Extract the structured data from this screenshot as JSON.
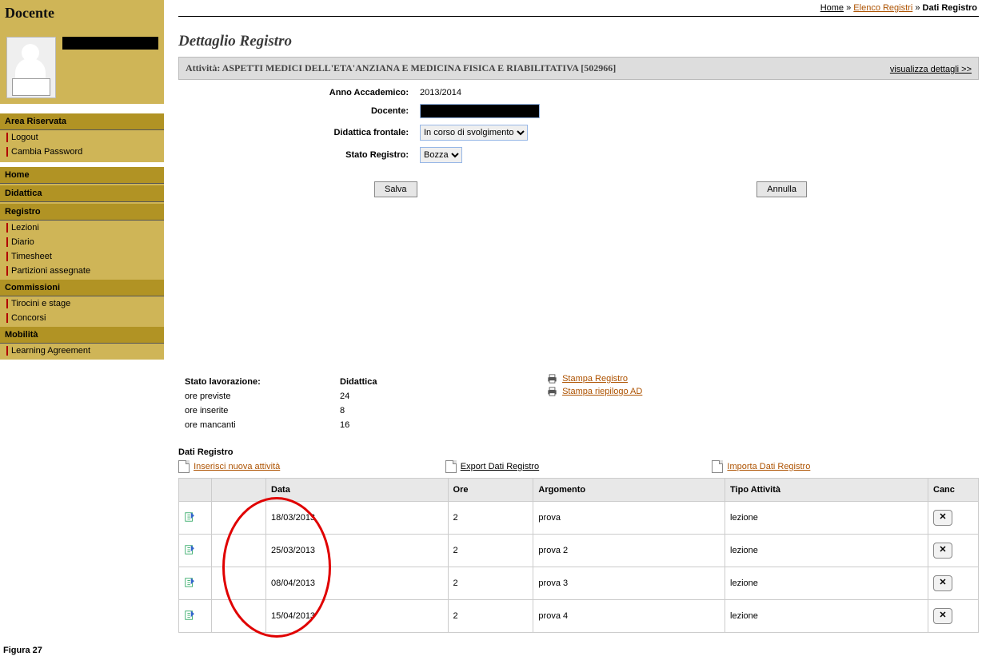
{
  "sidebar": {
    "title": "Docente",
    "area_label": "Area Riservata",
    "logout": "Logout",
    "change_pw": "Cambia Password",
    "nav": {
      "home": "Home",
      "didattica": "Didattica",
      "registro": "Registro",
      "registro_children": [
        "Lezioni",
        "Diario",
        "Timesheet",
        "Partizioni assegnate"
      ],
      "commissioni": "Commissioni",
      "commissioni_children": [
        "Tirocini e stage",
        "Concorsi"
      ],
      "mobilita": "Mobilità",
      "mobilita_children": [
        "Learning Agreement"
      ]
    }
  },
  "breadcrumb": {
    "home": "Home",
    "elenco": "Elenco Registri",
    "current": "Dati Registro"
  },
  "page_title": "Dettaglio Registro",
  "activity": {
    "label": "Attività: ASPETTI MEDICI DELL'ETA'ANZIANA E MEDICINA FISICA E RIABILITATIVA [502966]",
    "details_link": "visualizza dettagli >>"
  },
  "form": {
    "anno_label": "Anno Accademico:",
    "anno_value": "2013/2014",
    "docente_label": "Docente:",
    "didattica_label": "Didattica frontale:",
    "didattica_value": "In corso di svolgimento",
    "stato_label": "Stato Registro:",
    "stato_value": "Bozza"
  },
  "buttons": {
    "save": "Salva",
    "cancel": "Annulla"
  },
  "stats": {
    "stato_lav_label": "Stato lavorazione:",
    "didattica_head": "Didattica",
    "ore_prev_label": "ore previste",
    "ore_prev": "24",
    "ore_ins_label": "ore inserite",
    "ore_ins": "8",
    "ore_manc_label": "ore mancanti",
    "ore_manc": "16",
    "stampa_reg": "Stampa Registro",
    "stampa_riep": "Stampa riepilogo AD"
  },
  "data_section": {
    "title": "Dati Registro",
    "insert": "Inserisci nuova attività",
    "export": "Export Dati Registro",
    "import": "Importa Dati Registro",
    "cols": {
      "data": "Data",
      "ore": "Ore",
      "arg": "Argomento",
      "tipo": "Tipo Attività",
      "canc": "Canc"
    },
    "rows": [
      {
        "data": "18/03/2013",
        "ore": "2",
        "arg": "prova",
        "tipo": "lezione"
      },
      {
        "data": "25/03/2013",
        "ore": "2",
        "arg": "prova 2",
        "tipo": "lezione"
      },
      {
        "data": "08/04/2013",
        "ore": "2",
        "arg": "prova 3",
        "tipo": "lezione"
      },
      {
        "data": "15/04/2013",
        "ore": "2",
        "arg": "prova 4",
        "tipo": "lezione"
      }
    ]
  },
  "figure_caption": "Figura 27"
}
